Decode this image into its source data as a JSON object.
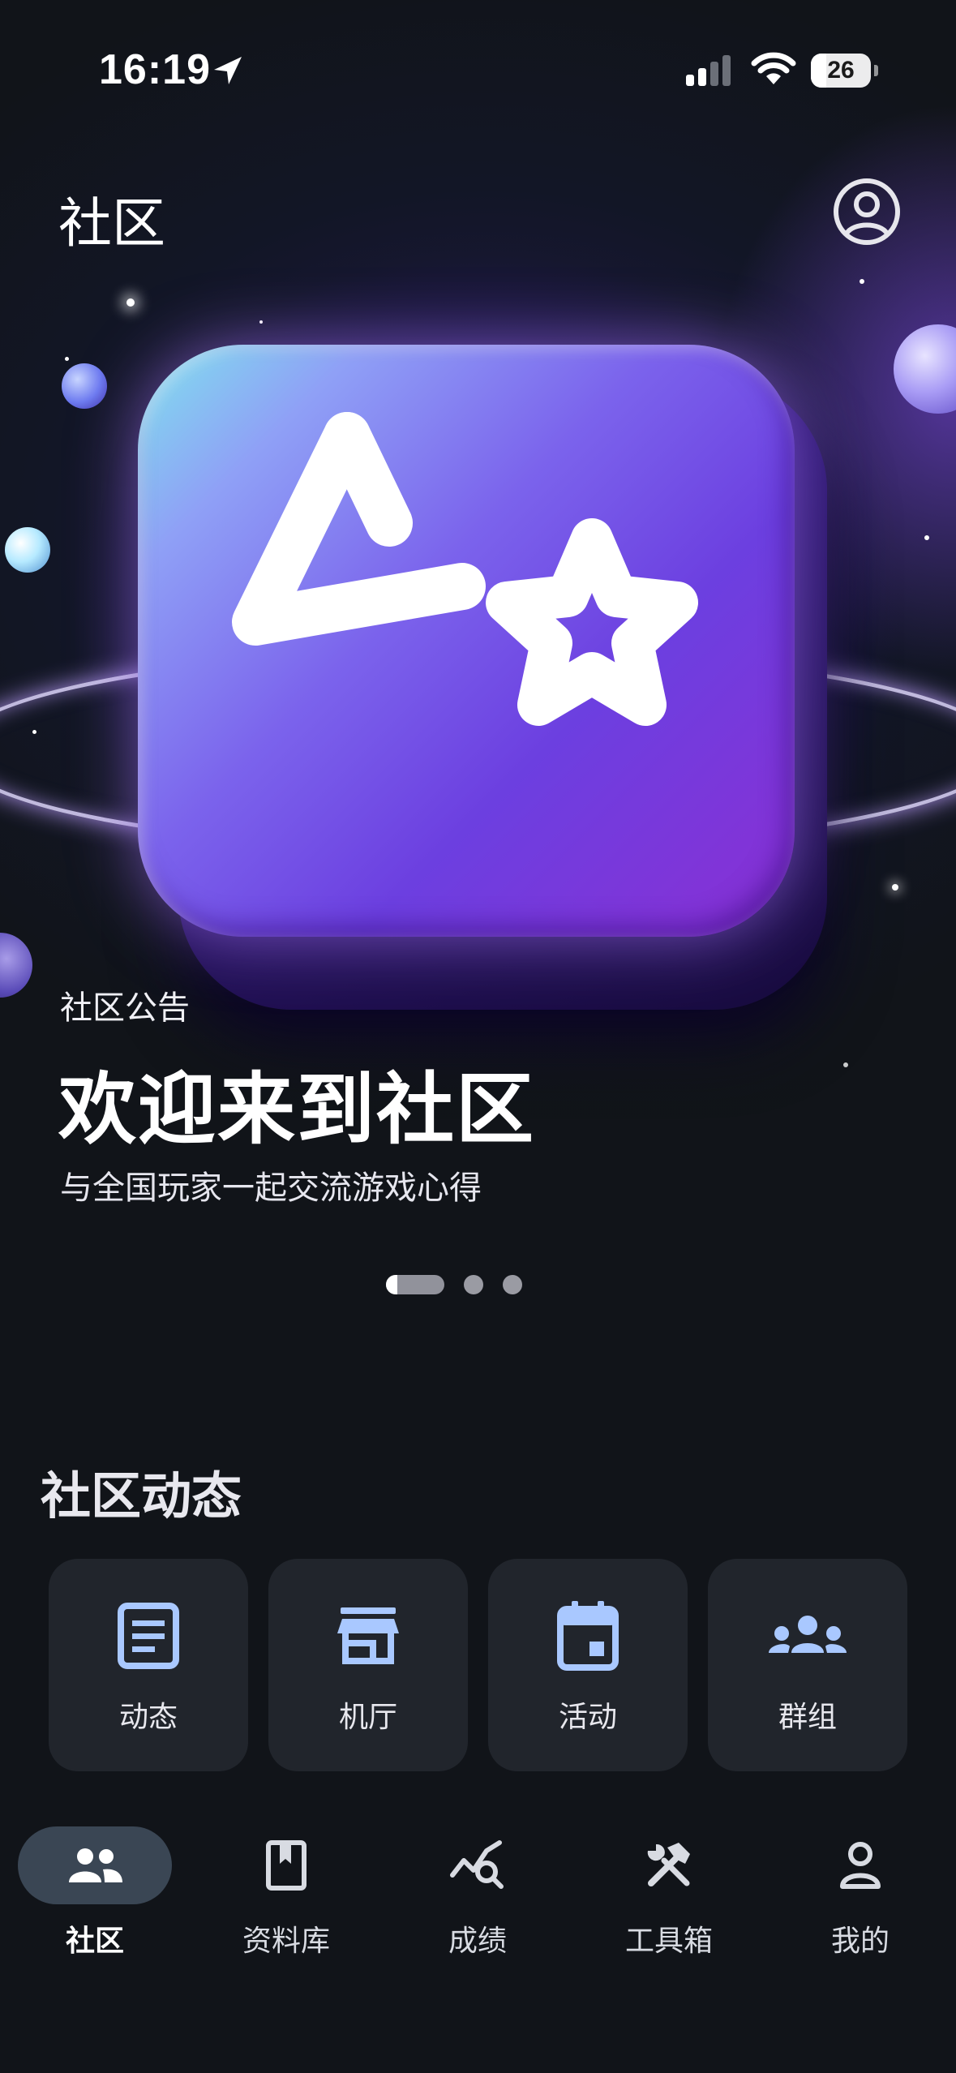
{
  "status_bar": {
    "time": "16:19",
    "battery_percent": "26",
    "battery_level": 0.26,
    "icons": [
      "location-arrow-icon",
      "signal-icon",
      "wifi-icon",
      "battery-icon"
    ]
  },
  "header": {
    "title": "社区",
    "profile_icon": "account-circle-icon"
  },
  "banner": {
    "tag": "社区公告",
    "title": "欢迎来到社区",
    "subtitle": "与全国玩家一起交流游戏心得",
    "page_count": 3,
    "active_page": 1
  },
  "section": {
    "title": "社区动态",
    "tiles": [
      {
        "label": "动态",
        "icon": "article-icon"
      },
      {
        "label": "机厅",
        "icon": "storefront-icon"
      },
      {
        "label": "活动",
        "icon": "calendar-event-icon"
      },
      {
        "label": "群组",
        "icon": "groups-icon"
      }
    ]
  },
  "bottom_nav": {
    "items": [
      {
        "label": "社区",
        "icon": "people-icon",
        "active": true
      },
      {
        "label": "资料库",
        "icon": "book-icon",
        "active": false
      },
      {
        "label": "成绩",
        "icon": "chart-search-icon",
        "active": false
      },
      {
        "label": "工具箱",
        "icon": "tools-icon",
        "active": false
      },
      {
        "label": "我的",
        "icon": "person-icon",
        "active": false
      }
    ]
  },
  "colors": {
    "background": "#111419",
    "tile_background": "#21252c",
    "icon_accent": "#a9c8ff",
    "nav_active_pill": "#3a4654"
  }
}
